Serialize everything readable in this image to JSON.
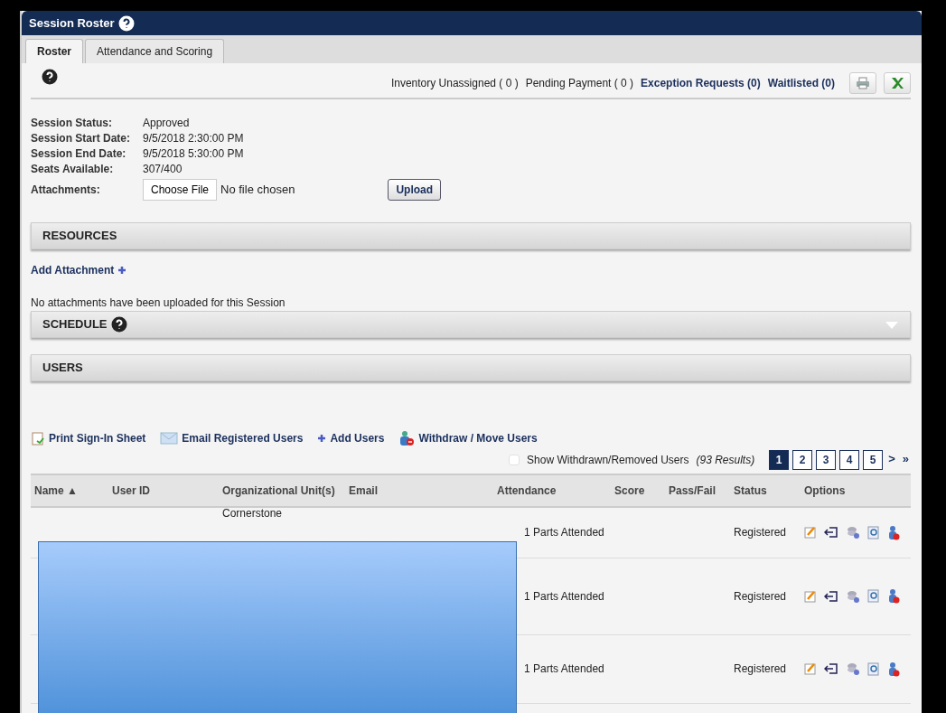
{
  "panel": {
    "title": "Session Roster"
  },
  "tabs": [
    {
      "label": "Roster",
      "selected": true
    },
    {
      "label": "Attendance and Scoring",
      "selected": false
    }
  ],
  "counts": [
    {
      "kind": "plain",
      "text": "Inventory Unassigned ( 0 )"
    },
    {
      "kind": "plain",
      "text": "Pending Payment ( 0 )"
    },
    {
      "kind": "link",
      "text": "Exception Requests (0)"
    },
    {
      "kind": "link",
      "text": "Waitlisted (0)"
    }
  ],
  "info": [
    {
      "label": "Session Status:",
      "value": "Approved"
    },
    {
      "label": "Session Start Date:",
      "value": "9/5/2018 2:30:00 PM"
    },
    {
      "label": "Session End Date:",
      "value": "9/5/2018 5:30:00 PM"
    },
    {
      "label": "Seats Available:",
      "value": "307/400"
    }
  ],
  "attachments": {
    "label": "Attachments:",
    "choose_button": "Choose File",
    "file_status": "No file chosen",
    "upload_button": "Upload"
  },
  "resources": {
    "title": "RESOURCES",
    "add_link": "Add Attachment",
    "empty_note": "No attachments have been uploaded for this Session"
  },
  "schedule": {
    "title": "SCHEDULE",
    "expanded": false
  },
  "users": {
    "title": "USERS"
  },
  "actions": [
    {
      "kind": "print",
      "label": "Print Sign-In Sheet"
    },
    {
      "kind": "email",
      "label": "Email Registered Users"
    },
    {
      "kind": "add",
      "label": "Add Users"
    },
    {
      "kind": "withdraw",
      "label": "Withdraw / Move Users"
    }
  ],
  "show_withdrawn": {
    "label": "Show Withdrawn/Removed Users",
    "checked": false
  },
  "results": "(93 Results)",
  "pages": [
    {
      "label": "1",
      "selected": true
    },
    {
      "label": "2",
      "selected": false
    },
    {
      "label": "3",
      "selected": false
    },
    {
      "label": "4",
      "selected": false
    },
    {
      "label": "5",
      "selected": false
    }
  ],
  "page_nav": [
    ">",
    "»"
  ],
  "table": {
    "columns": [
      "Name ▲",
      "User ID",
      "Organizational Unit(s)",
      "Email",
      "Attendance",
      "Score",
      "Pass/Fail",
      "Status",
      "Options"
    ],
    "rows": [
      {
        "org": "Cornerstone",
        "attendance": "1 Parts Attended",
        "status": "Registered"
      },
      {
        "attendance": "1 Parts Attended",
        "status": "Registered"
      },
      {
        "attendance": "1 Parts Attended",
        "status": "Registered"
      }
    ]
  }
}
